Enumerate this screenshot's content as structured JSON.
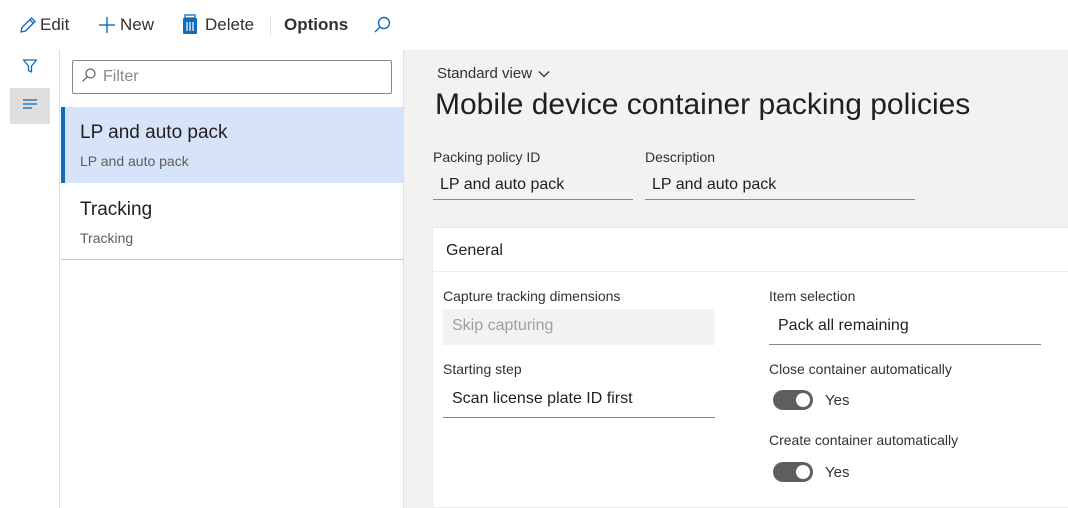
{
  "toolbar": {
    "edit_label": "Edit",
    "new_label": "New",
    "delete_label": "Delete",
    "options_label": "Options",
    "edit_icon": "pencil-icon",
    "new_icon": "plus-icon",
    "delete_icon": "trash-icon",
    "search_icon": "search-icon"
  },
  "rail": {
    "items": [
      {
        "icon": "filter-icon"
      },
      {
        "icon": "list-icon",
        "active": true
      }
    ]
  },
  "list": {
    "filter_placeholder": "Filter",
    "items": [
      {
        "title": "LP and auto pack",
        "subtitle": "LP and auto pack",
        "selected": true
      },
      {
        "title": "Tracking",
        "subtitle": "Tracking",
        "selected": false
      }
    ]
  },
  "details": {
    "view_label": "Standard view",
    "title": "Mobile device container packing policies",
    "policy_id_label": "Packing policy ID",
    "policy_id_value": "LP and auto pack",
    "description_label": "Description",
    "description_value": "LP and auto pack",
    "general": {
      "header": "General",
      "capture_label": "Capture tracking dimensions",
      "capture_value": "Skip capturing",
      "starting_step_label": "Starting step",
      "starting_step_value": "Scan license plate ID first",
      "item_selection_label": "Item selection",
      "item_selection_value": "Pack all remaining",
      "close_container_label": "Close container automatically",
      "close_container_value": "Yes",
      "create_container_label": "Create container automatically",
      "create_container_value": "Yes"
    }
  },
  "colors": {
    "accent": "#0f6cbd",
    "selected_bg": "#d6e3f8",
    "toggle_on": "#605e5c"
  }
}
